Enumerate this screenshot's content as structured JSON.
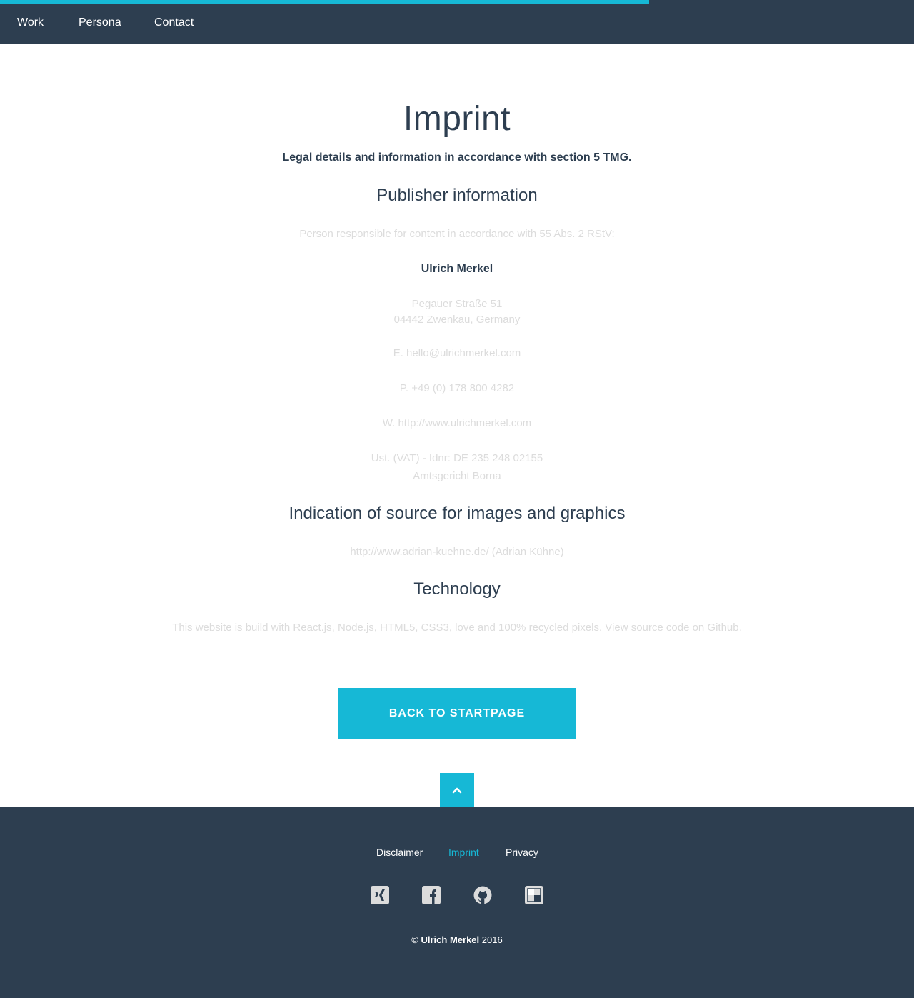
{
  "colors": {
    "accent": "#16b8d6",
    "dark": "#2d3e50",
    "muted_text": "#dcdcdc",
    "white": "#ffffff"
  },
  "progress": {
    "percent": 71
  },
  "nav": {
    "items": [
      {
        "label": "Work"
      },
      {
        "label": "Persona"
      },
      {
        "label": "Contact"
      }
    ]
  },
  "page": {
    "title": "Imprint",
    "lead": "Legal details and information in accordance with section 5 TMG.",
    "publisher": {
      "heading": "Publisher information",
      "responsible": "Person responsible for content in accordance with 55 Abs. 2 RStV:",
      "name": "Ulrich Merkel",
      "street": "Pegauer Straße 51",
      "city": "04442 Zwenkau, Germany",
      "email": "E. hello@ulrichmerkel.com",
      "phone": "P. +49 (0) 178 800 4282",
      "web": "W. http://www.ulrichmerkel.com",
      "vat": "Ust. (VAT) - Idnr: DE 235 248 02155",
      "court": "Amtsgericht Borna"
    },
    "sources": {
      "heading": "Indication of source for images and graphics",
      "text": "http://www.adrian-kuehne.de/ (Adrian Kühne)"
    },
    "technology": {
      "heading": "Technology",
      "text": "This website is build with React.js, Node.js, HTML5, CSS3, love and 100% recycled pixels. View source code on Github."
    },
    "back_button": "BACK TO STARTPAGE",
    "up_button_icon": "chevron-up-icon"
  },
  "footer": {
    "links": [
      {
        "label": "Disclaimer"
      },
      {
        "label": "Imprint",
        "active": true
      },
      {
        "label": "Privacy"
      }
    ],
    "social_icons": [
      "xing-icon",
      "facebook-icon",
      "github-icon",
      "delicious-icon"
    ],
    "copyright": {
      "symbol": "©",
      "name": "Ulrich Merkel",
      "year": "2016"
    }
  }
}
